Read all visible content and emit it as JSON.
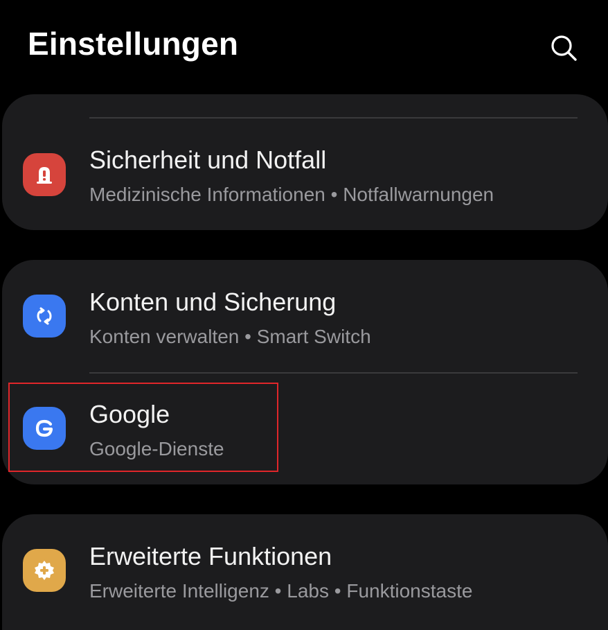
{
  "header": {
    "title": "Einstellungen",
    "search_icon": "search-icon"
  },
  "items": [
    {
      "label": "Sicherheit und Notfall",
      "sub": "Medizinische Informationen  •  Notfallwarnungen",
      "icon": "alert-icon",
      "icon_color": "#d6443c"
    },
    {
      "label": "Konten und Sicherung",
      "sub": "Konten verwalten  •  Smart Switch",
      "icon": "sync-icon",
      "icon_color": "#3a78f0"
    },
    {
      "label": "Google",
      "sub": "Google-Dienste",
      "icon": "google-g-icon",
      "icon_color": "#3a78f0",
      "highlighted": true
    },
    {
      "label": "Erweiterte Funktionen",
      "sub": "Erweiterte Intelligenz  •  Labs  •  Funktionstaste",
      "icon": "advanced-features-icon",
      "icon_color": "#e0a84a"
    }
  ],
  "colors": {
    "background": "#000000",
    "card": "#1c1c1e",
    "highlight_border": "#e0262a"
  }
}
